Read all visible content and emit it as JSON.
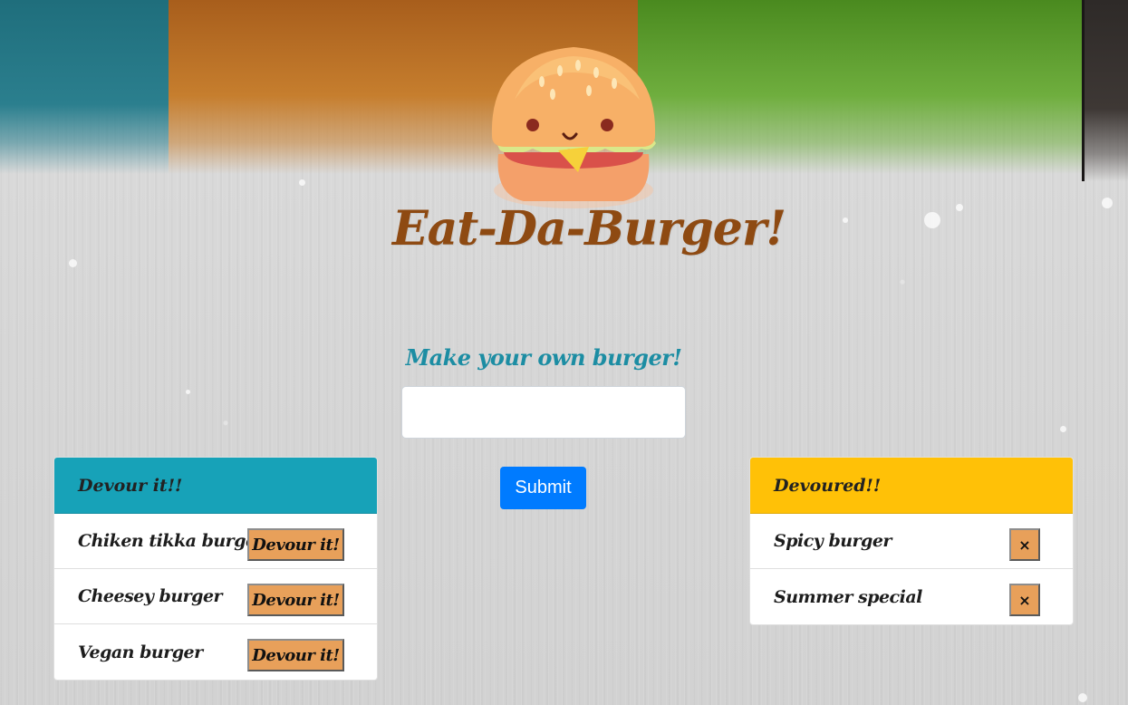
{
  "header": {
    "title": "Eat-Da-Burger!",
    "logo_icon": "burger-logo-icon"
  },
  "form": {
    "heading": "Make your own burger!",
    "input_value": "",
    "input_placeholder": "",
    "submit_label": "Submit"
  },
  "devour_list": {
    "title": "Devour it!!",
    "header_color": "#17a2b8",
    "button_label": "Devour it!",
    "items": [
      {
        "name": "Chiken tikka burger"
      },
      {
        "name": "Cheesey burger"
      },
      {
        "name": "Vegan burger"
      }
    ]
  },
  "devoured_list": {
    "title": "Devoured!!",
    "header_color": "#ffc107",
    "button_label": "×",
    "items": [
      {
        "name": "Spicy burger"
      },
      {
        "name": "Summer special"
      }
    ]
  },
  "colors": {
    "title": "#8e4a12",
    "form_heading": "#1c8da3",
    "submit": "#007bff",
    "action_button": "#e8a05a"
  }
}
